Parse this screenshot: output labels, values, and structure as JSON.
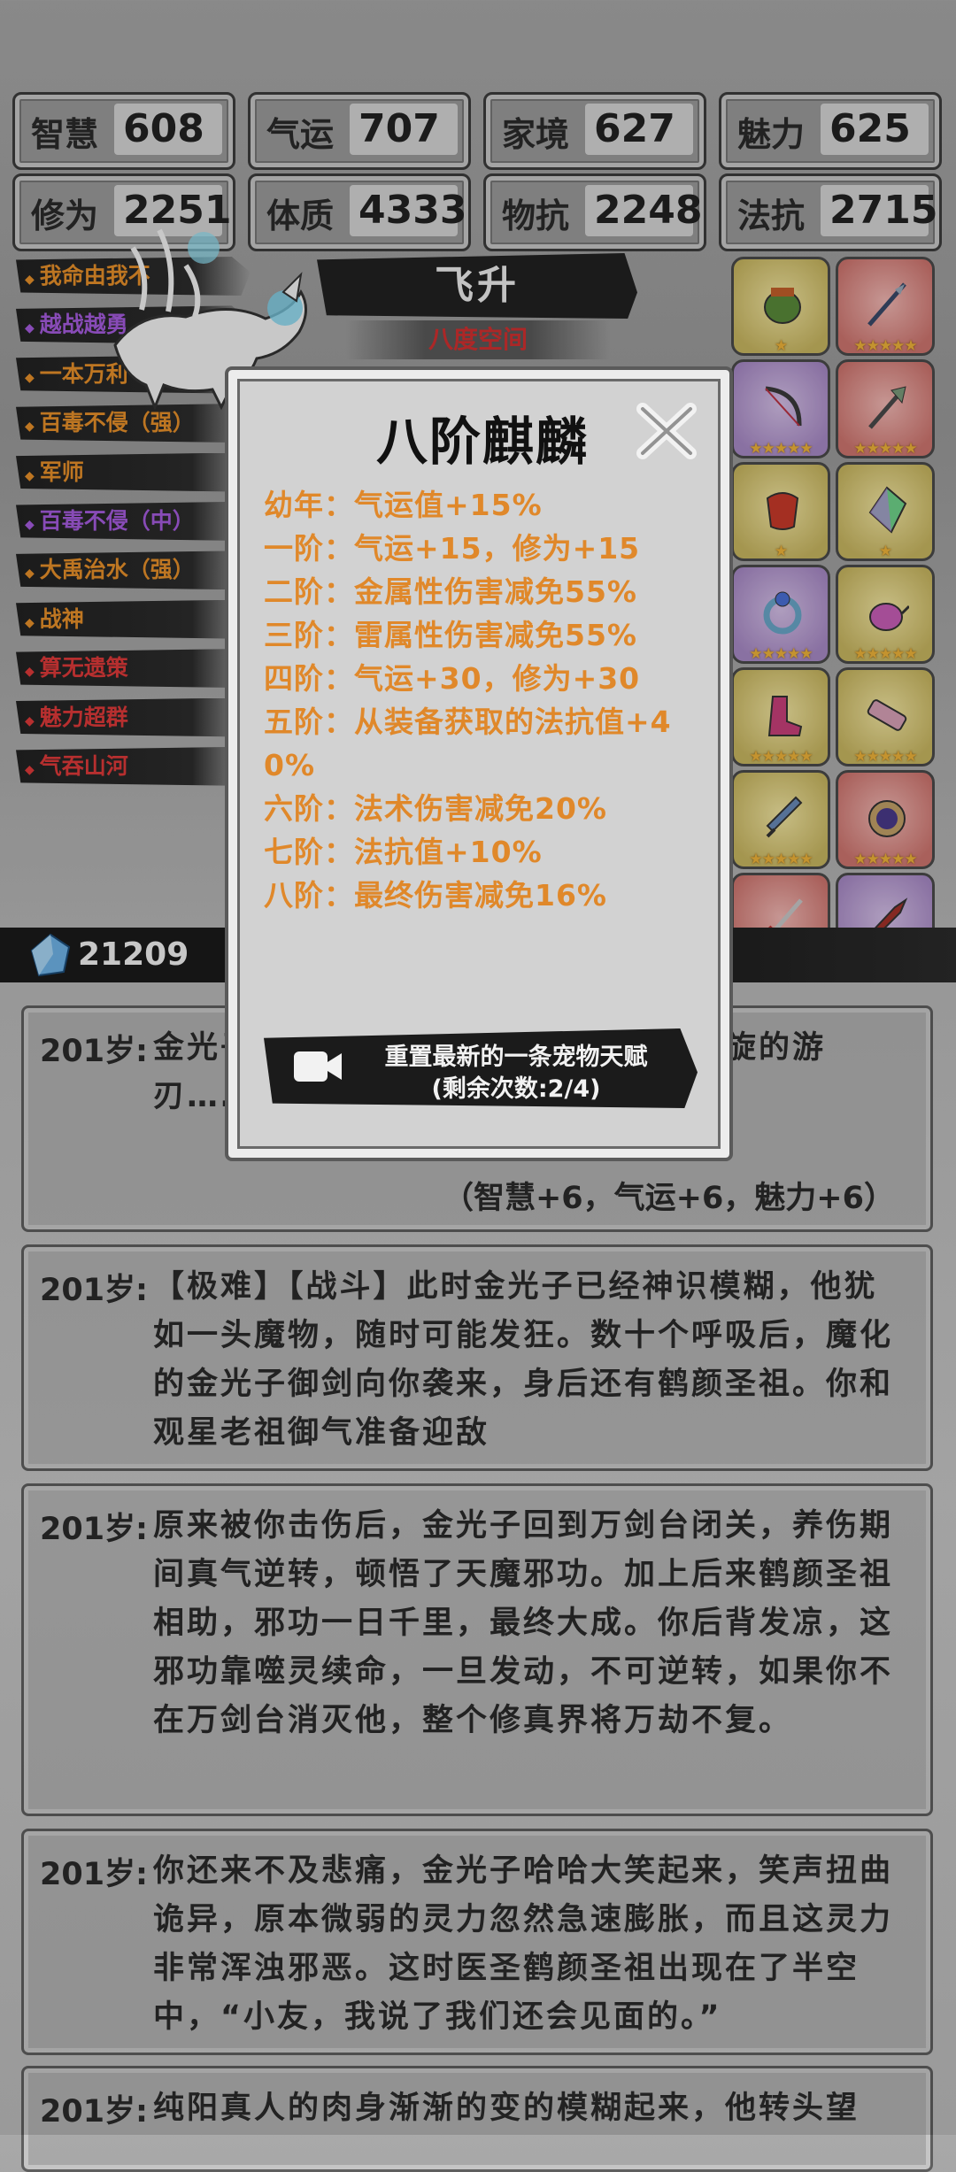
{
  "stats_row1": [
    {
      "label": "智慧",
      "value": "608"
    },
    {
      "label": "气运",
      "value": "707"
    },
    {
      "label": "家境",
      "value": "627"
    },
    {
      "label": "魅力",
      "value": "625"
    }
  ],
  "stats_row2": [
    {
      "label": "修为",
      "value": "2251"
    },
    {
      "label": "体质",
      "value": "4333"
    },
    {
      "label": "物抗",
      "value": "2248"
    },
    {
      "label": "法抗",
      "value": "2715"
    }
  ],
  "talents": [
    {
      "label": "我命由我不",
      "color": "orange"
    },
    {
      "label": "越战越勇",
      "color": "purple"
    },
    {
      "label": "一本万利",
      "color": "orange"
    },
    {
      "label": "百毒不侵（强）",
      "color": "orange"
    },
    {
      "label": "军师",
      "color": "orange"
    },
    {
      "label": "百毒不侵（中）",
      "color": "purple"
    },
    {
      "label": "大禹治水（强）",
      "color": "orange"
    },
    {
      "label": "战神",
      "color": "orange"
    },
    {
      "label": "算无遗策",
      "color": "red"
    },
    {
      "label": "魅力超群",
      "color": "red"
    },
    {
      "label": "气吞山河",
      "color": "red"
    }
  ],
  "stage": {
    "title": "飞升",
    "subtitle": "八度空间"
  },
  "equipment": [
    {
      "icon": "bronze-cauldron-icon",
      "rarity": "gold",
      "stars": 3
    },
    {
      "icon": "spear-icon",
      "rarity": "red",
      "stars": 5
    },
    {
      "icon": "bow-icon",
      "rarity": "purple",
      "stars": 5
    },
    {
      "icon": "halberd-icon",
      "rarity": "red",
      "stars": 5
    },
    {
      "icon": "red-armor-icon",
      "rarity": "gold",
      "stars": 1
    },
    {
      "icon": "crystal-gem-icon",
      "rarity": "gold",
      "stars": 1
    },
    {
      "icon": "ring-icon",
      "rarity": "purple",
      "stars": 5
    },
    {
      "icon": "teapot-icon",
      "rarity": "gold",
      "stars": 5
    },
    {
      "icon": "boots-icon",
      "rarity": "gold",
      "stars": 5
    },
    {
      "icon": "scroll-icon",
      "rarity": "gold",
      "stars": 5
    },
    {
      "icon": "dagger-icon",
      "rarity": "gold",
      "stars": 5
    },
    {
      "icon": "mirror-icon",
      "rarity": "red",
      "stars": 5
    },
    {
      "icon": "sword-icon",
      "rarity": "red",
      "stars": 5
    },
    {
      "icon": "blade-icon",
      "rarity": "purple",
      "stars": 1
    }
  ],
  "currency": {
    "icon": "spirit-stone-icon",
    "value": "21209"
  },
  "logs": [
    {
      "age": "201岁:",
      "text": "金光子……的辅助，招招致……与其周旋的游刃……上风。",
      "bonus": "（智慧+6，气运+6，魅力+6）"
    },
    {
      "age": "201岁:",
      "text": "【极难】【战斗】此时金光子已经神识模糊，他犹如一头魔物，随时可能发狂。数十个呼吸后，魔化的金光子御剑向你袭来，身后还有鹤颜圣祖。你和观星老祖御气准备迎敌",
      "bonus": ""
    },
    {
      "age": "201岁:",
      "text": "原来被你击伤后，金光子回到万剑台闭关，养伤期间真气逆转，顿悟了天魔邪功。加上后来鹤颜圣祖相助，邪功一日千里，最终大成。你后背发凉，这邪功靠噬灵续命，一旦发动，不可逆转，如果你不在万剑台消灭他，整个修真界将万劫不复。",
      "bonus": ""
    },
    {
      "age": "201岁:",
      "text": "你还来不及悲痛，金光子哈哈大笑起来，笑声扭曲诡异，原本微弱的灵力忽然急速膨胀，而且这灵力非常浑浊邪恶。这时医圣鹤颜圣祖出现在了半空中，“小友，我说了我们还会见面的。”",
      "bonus": ""
    },
    {
      "age": "201岁:",
      "text": "纯阳真人的肉身渐渐的变的模糊起来，他转头望",
      "bonus": ""
    }
  ],
  "modal": {
    "title": "八阶麒麟",
    "lines": [
      "幼年：气运值+15%",
      "一阶：气运+15，修为+15",
      "二阶：金属性伤害减免55%",
      "三阶：雷属性伤害减免55%",
      "四阶：气运+30，修为+30",
      "五阶：从装备获取的法抗值+40%",
      "六阶：法术伤害减免20%",
      "七阶：法抗值+10%",
      "八阶：最终伤害减免16%"
    ],
    "reset_line1": "重置最新的一条宠物天赋",
    "reset_line2": "(剩余次数:2/4)"
  },
  "colors": {
    "orange": "#e8912a",
    "purple": "#a65ce0",
    "red": "#e03a3a",
    "gold_frame": "#c9b761",
    "modal_text": "#e0882a"
  }
}
